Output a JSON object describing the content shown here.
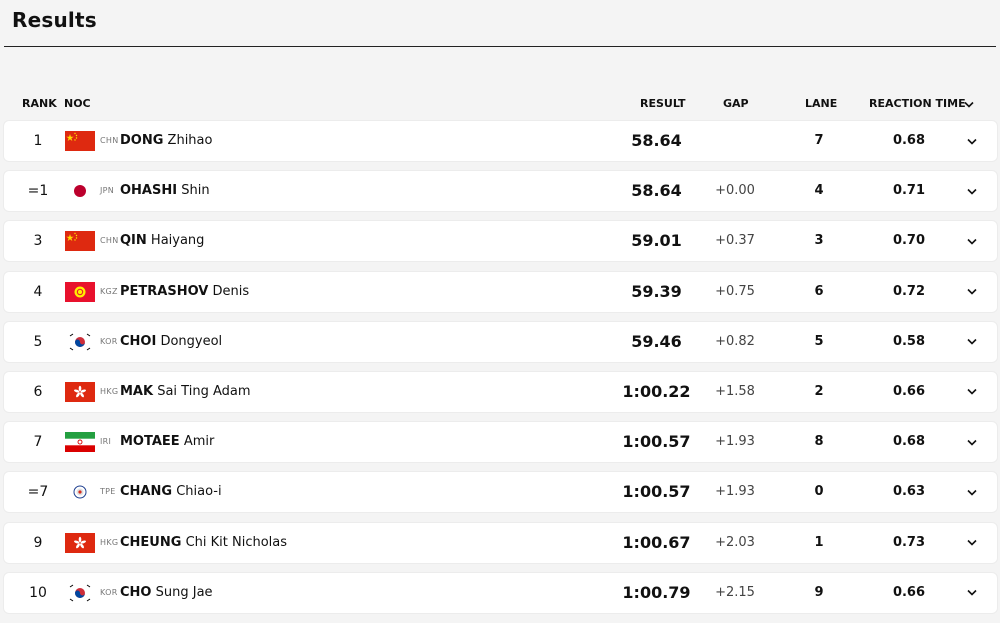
{
  "title": "Results",
  "columns": {
    "rank": "RANK",
    "noc": "NOC",
    "result": "RESULT",
    "gap": "GAP",
    "lane": "LANE",
    "reaction": "REACTION TIME"
  },
  "rows": [
    {
      "rank": "1",
      "noc": "CHN",
      "last": "DONG",
      "first": "Zhihao",
      "result": "58.64",
      "gap": "",
      "lane": "7",
      "reaction": "0.68",
      "flag": "chn"
    },
    {
      "rank": "=1",
      "noc": "JPN",
      "last": "OHASHI",
      "first": "Shin",
      "result": "58.64",
      "gap": "+0.00",
      "lane": "4",
      "reaction": "0.71",
      "flag": "jpn"
    },
    {
      "rank": "3",
      "noc": "CHN",
      "last": "QIN",
      "first": "Haiyang",
      "result": "59.01",
      "gap": "+0.37",
      "lane": "3",
      "reaction": "0.70",
      "flag": "chn"
    },
    {
      "rank": "4",
      "noc": "KGZ",
      "last": "PETRASHOV",
      "first": "Denis",
      "result": "59.39",
      "gap": "+0.75",
      "lane": "6",
      "reaction": "0.72",
      "flag": "kgz"
    },
    {
      "rank": "5",
      "noc": "KOR",
      "last": "CHOI",
      "first": "Dongyeol",
      "result": "59.46",
      "gap": "+0.82",
      "lane": "5",
      "reaction": "0.58",
      "flag": "kor"
    },
    {
      "rank": "6",
      "noc": "HKG",
      "last": "MAK",
      "first": "Sai Ting Adam",
      "result": "1:00.22",
      "gap": "+1.58",
      "lane": "2",
      "reaction": "0.66",
      "flag": "hkg"
    },
    {
      "rank": "7",
      "noc": "IRI",
      "last": "MOTAEE",
      "first": "Amir",
      "result": "1:00.57",
      "gap": "+1.93",
      "lane": "8",
      "reaction": "0.68",
      "flag": "iri"
    },
    {
      "rank": "=7",
      "noc": "TPE",
      "last": "CHANG",
      "first": "Chiao-i",
      "result": "1:00.57",
      "gap": "+1.93",
      "lane": "0",
      "reaction": "0.63",
      "flag": "tpe"
    },
    {
      "rank": "9",
      "noc": "HKG",
      "last": "CHEUNG",
      "first": "Chi Kit Nicholas",
      "result": "1:00.67",
      "gap": "+2.03",
      "lane": "1",
      "reaction": "0.73",
      "flag": "hkg"
    },
    {
      "rank": "10",
      "noc": "KOR",
      "last": "CHO",
      "first": "Sung Jae",
      "result": "1:00.79",
      "gap": "+2.15",
      "lane": "9",
      "reaction": "0.66",
      "flag": "kor"
    }
  ]
}
